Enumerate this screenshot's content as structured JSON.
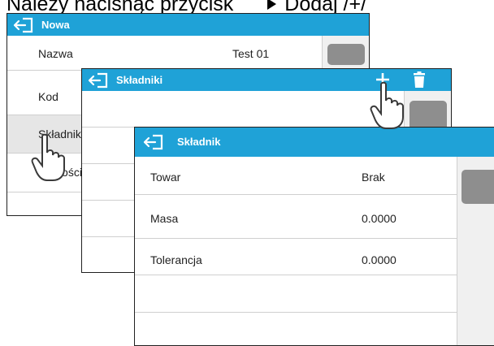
{
  "caption": {
    "prefix": "Należy nacisnąć przycisk",
    "suffix": "Dodaj /+/"
  },
  "win1": {
    "title": "Nowa",
    "rows": [
      {
        "label": "Nazwa",
        "value": "Test 01"
      },
      {
        "label": "Kod",
        "value": ""
      },
      {
        "label": "Składniki",
        "value": ""
      },
      {
        "label": "Wartości",
        "value": ""
      }
    ]
  },
  "win2": {
    "title": "Składniki"
  },
  "win3": {
    "title": "Składnik",
    "rows": [
      {
        "label": "Towar",
        "value": "Brak"
      },
      {
        "label": "Masa",
        "value": "0.0000"
      },
      {
        "label": "Tolerancja",
        "value": "0.0000"
      }
    ]
  },
  "colors": {
    "titlebar": "#1fa2d7",
    "selected_row": "#e6e6e6",
    "scroll_thumb": "#8e8e8e"
  }
}
